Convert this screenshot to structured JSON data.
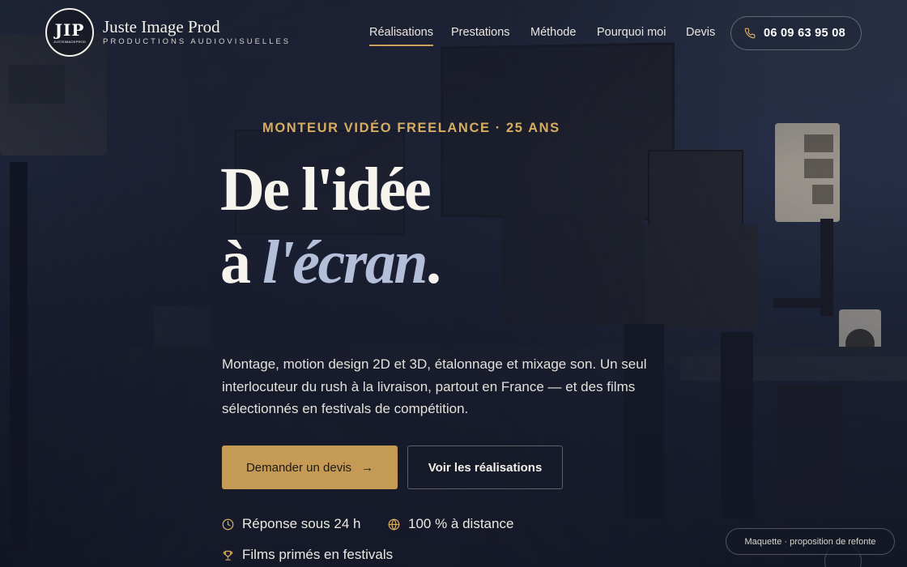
{
  "brand": {
    "logo_text": "JIP",
    "logo_subtext": "JUSTEIMAGEPROD",
    "name": "Juste Image Prod",
    "tagline": "PRODUCTIONS AUDIOVISUELLES"
  },
  "nav": {
    "items": [
      {
        "label": "Réalisations",
        "active": true
      },
      {
        "label": "Prestations",
        "active": false
      },
      {
        "label": "Méthode",
        "active": false
      },
      {
        "label": "Pourquoi moi",
        "active": false
      },
      {
        "label": "Devis",
        "active": false
      }
    ],
    "phone": "06 09 63 95 08",
    "phone_icon": "phone-icon"
  },
  "hero": {
    "eyebrow": "MONTEUR VIDÉO FREELANCE · 25 ANS",
    "title_line1": "De l'idée",
    "title_line2_start": "à ",
    "title_line2_italic": "l'écran",
    "title_line2_end": ".",
    "lead": "Montage, motion design 2D et 3D, étalonnage et mixage son. Un seul interlocuteur du rush à la livraison, partout en France — et des films sélectionnés en festivals de compétition.",
    "primary_cta": "Demander un devis",
    "primary_cta_icon": "arrow-right-icon",
    "secondary_cta": "Voir les réalisations",
    "features": [
      {
        "icon": "clock-icon",
        "label": "Réponse sous 24 h"
      },
      {
        "icon": "globe-icon",
        "label": "100 % à distance"
      },
      {
        "icon": "trophy-icon",
        "label": "Films primés en festivals"
      }
    ]
  },
  "badge": {
    "text": "Maquette · proposition de refonte"
  },
  "colors": {
    "accent": "#c49a55",
    "eyebrow": "#d8ad62",
    "title_italic": "#b3bfd8",
    "background": "#1f2436"
  }
}
